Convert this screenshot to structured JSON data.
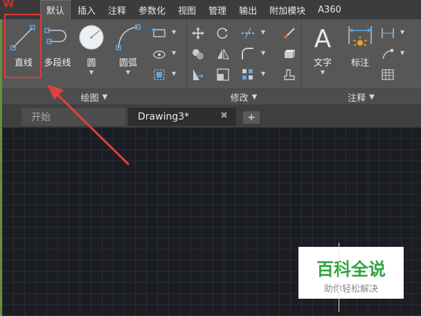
{
  "ribbon_tabs": [
    {
      "label": "默认",
      "active": true
    },
    {
      "label": "插入"
    },
    {
      "label": "注释"
    },
    {
      "label": "参数化"
    },
    {
      "label": "视图"
    },
    {
      "label": "管理"
    },
    {
      "label": "输出"
    },
    {
      "label": "附加模块"
    },
    {
      "label": "A360"
    }
  ],
  "panels": {
    "draw": {
      "title": "绘图",
      "tools": {
        "line": "直线",
        "polyline": "多段线",
        "circle": "圆",
        "arc": "圆弧"
      }
    },
    "modify": {
      "title": "修改"
    },
    "annotation": {
      "title": "注释",
      "tools": {
        "text": "文字",
        "dimension": "标注"
      }
    }
  },
  "doc_tabs": [
    {
      "label": "开始"
    },
    {
      "label": "Drawing3*",
      "active": true
    }
  ],
  "add_tab_label": "+",
  "close_glyph": "✖",
  "watermark": {
    "main": "百科全说",
    "sub": "助你轻松解决"
  },
  "colors": {
    "accent_highlight": "#e03a3a",
    "watermark_green": "#2fa53e",
    "ribbon_bg": "#575757",
    "canvas_bg": "#1b1d23"
  }
}
